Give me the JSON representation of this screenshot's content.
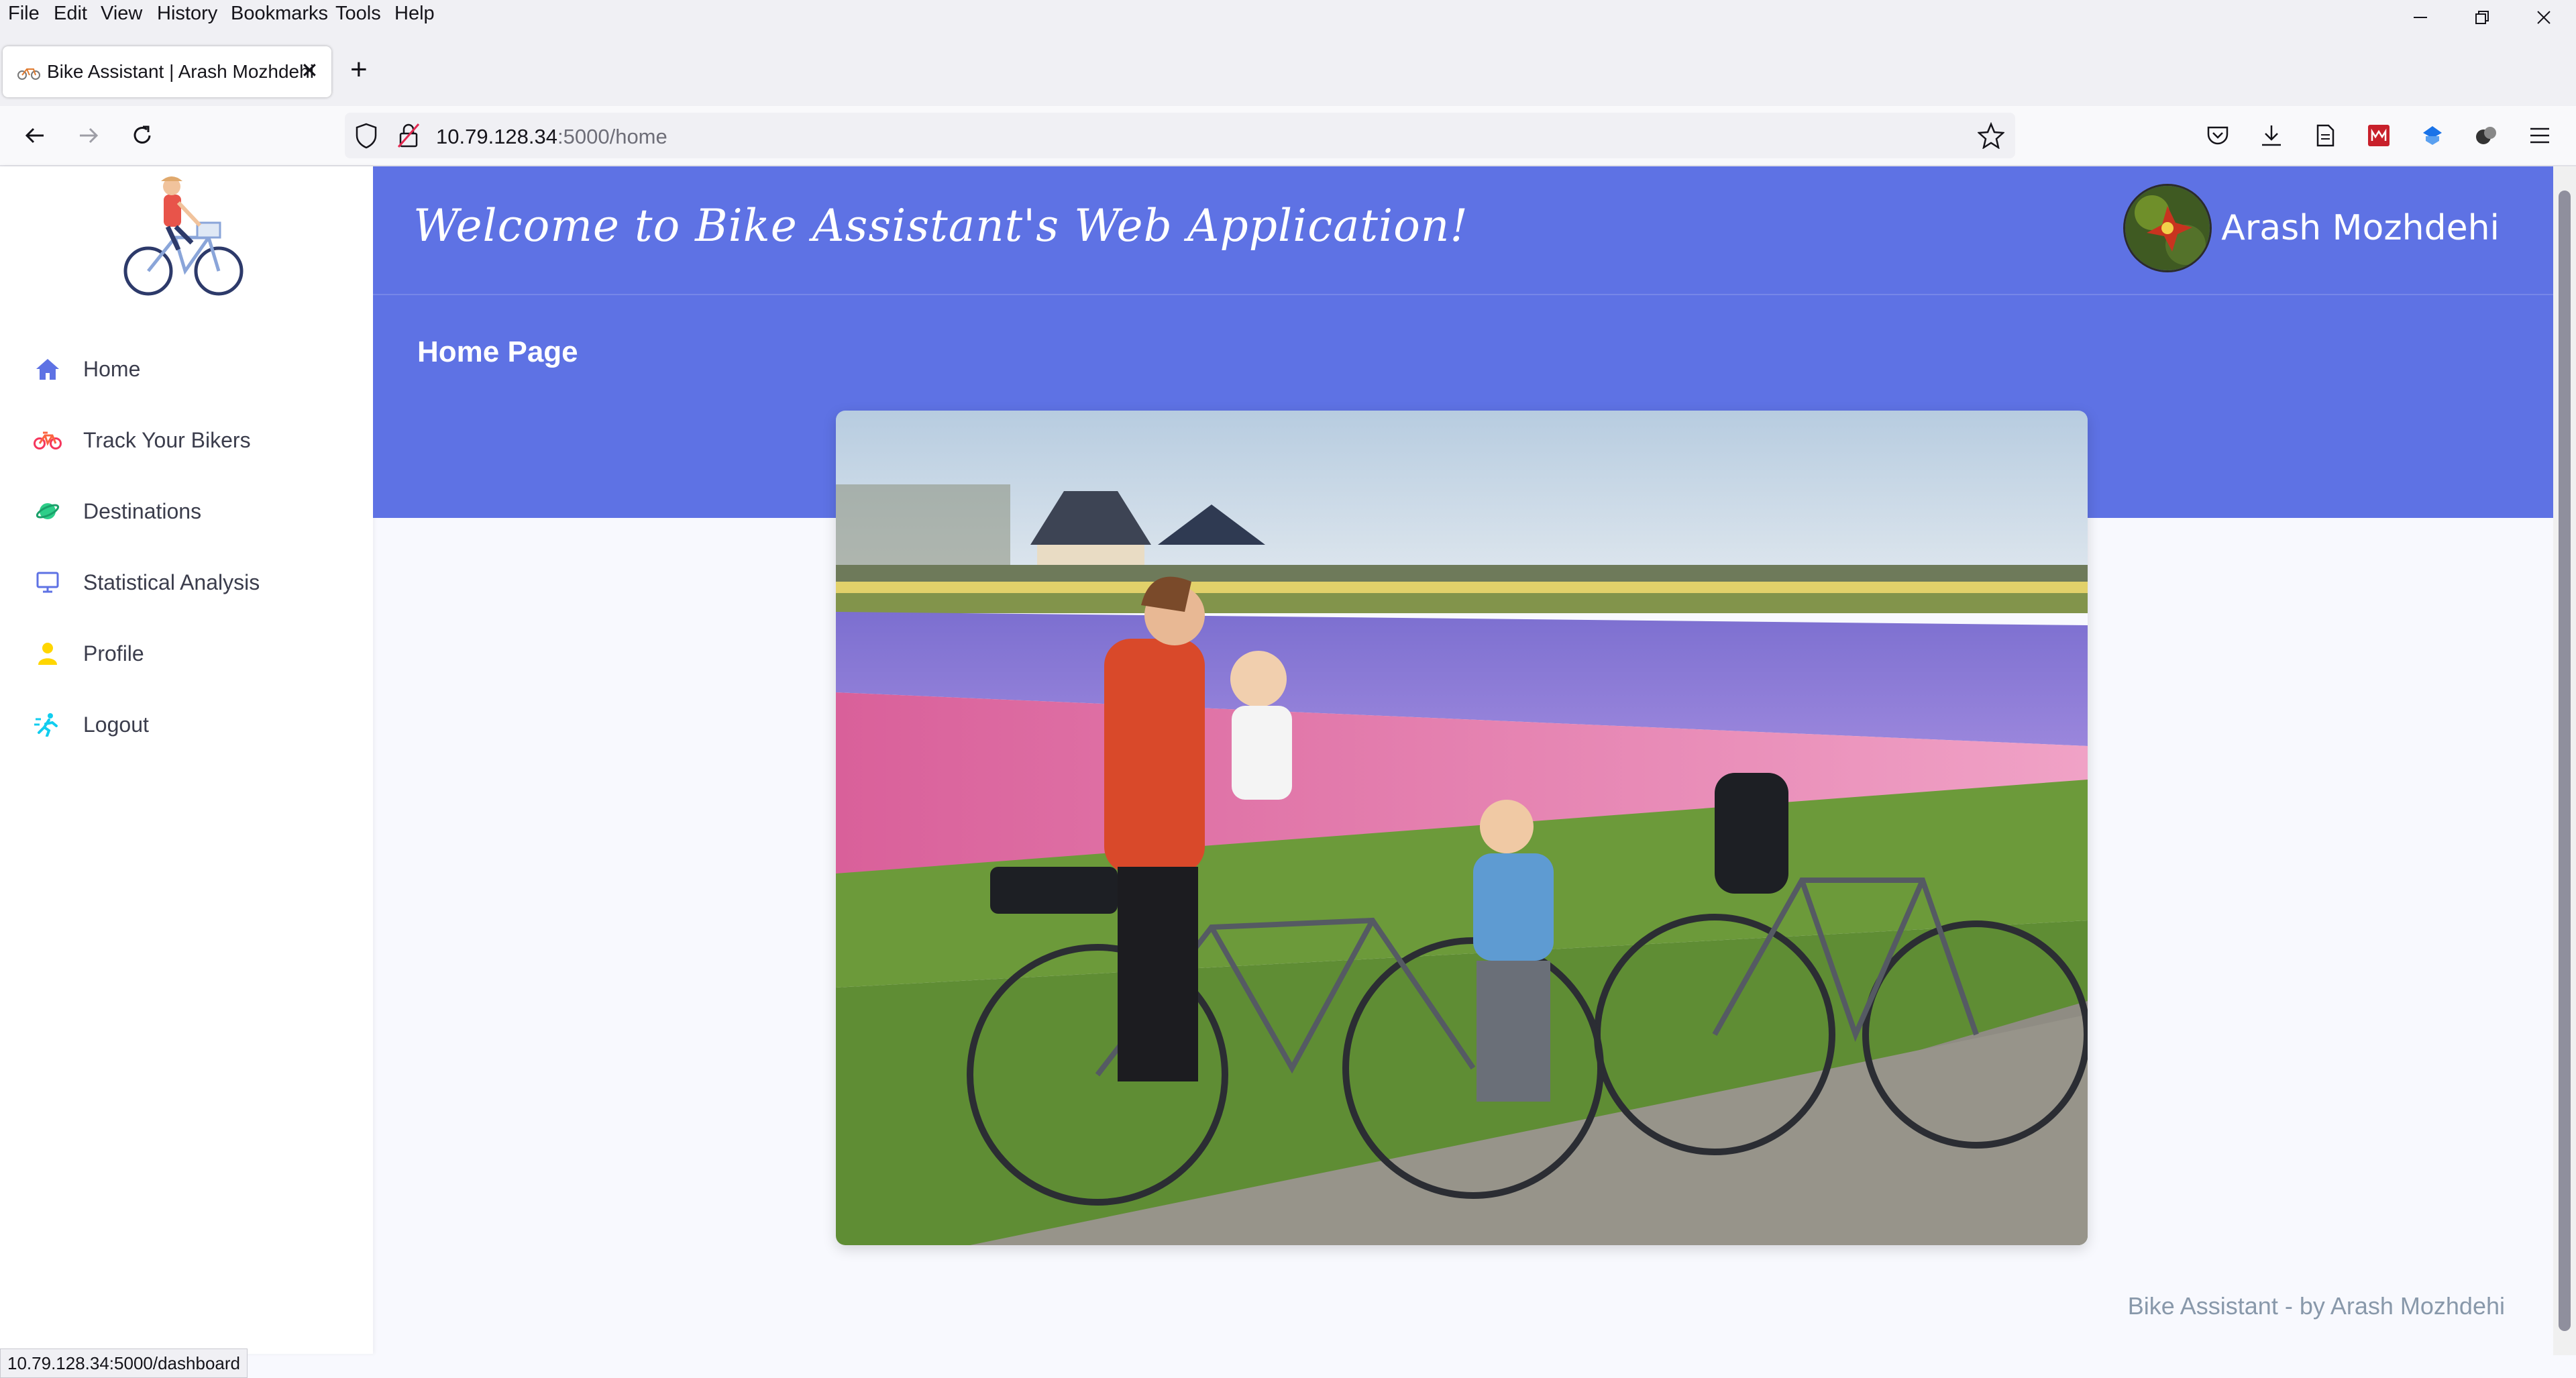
{
  "menu": [
    "File",
    "Edit",
    "View",
    "History",
    "Bookmarks",
    "Tools",
    "Help"
  ],
  "tab": {
    "title": "Bike Assistant | Arash Mozhdehi"
  },
  "url": {
    "host": "10.79.128.34",
    "path": ":5000/home"
  },
  "sidebar": {
    "items": [
      {
        "label": "Home",
        "icon": "home-icon",
        "color": "#5e72e4"
      },
      {
        "label": "Track Your Bikers",
        "icon": "bike-icon",
        "color": "#f5365c"
      },
      {
        "label": "Destinations",
        "icon": "planet-icon",
        "color": "#2dce89"
      },
      {
        "label": "Statistical Analysis",
        "icon": "monitor-icon",
        "color": "#5e72e4"
      },
      {
        "label": "Profile",
        "icon": "user-icon",
        "color": "#ffd600"
      },
      {
        "label": "Logout",
        "icon": "running-icon",
        "color": "#11cdef"
      }
    ]
  },
  "header": {
    "welcome": "Welcome to Bike Assistant's Web Application!",
    "user_name": "Arash Mozhdehi",
    "page_title": "Home Page"
  },
  "footer": {
    "text": "Bike Assistant - by Arash Mozhdehi"
  },
  "status_url": "10.79.128.34:5000/dashboard",
  "colors": {
    "primary": "#5e72e4",
    "background": "#f8f9fe"
  }
}
